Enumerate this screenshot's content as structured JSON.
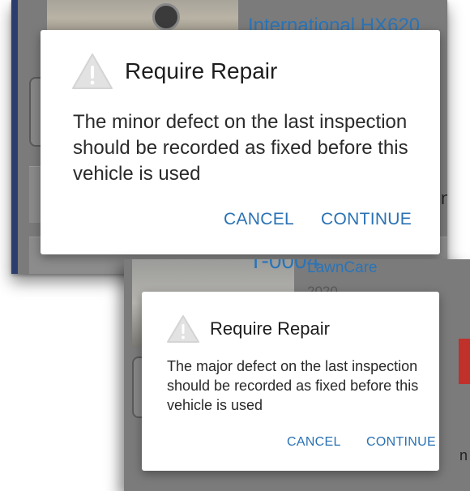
{
  "screen_top": {
    "background": {
      "vehicle_title": "International HX620"
    },
    "dialog": {
      "title": "Require Repair",
      "message": "The minor defect on the last inspection should be recorded as fixed before this vehicle is used",
      "cancel_label": "CANCEL",
      "continue_label": "CONTINUE",
      "icon": "warning-triangle-icon"
    }
  },
  "screen_bottom": {
    "background": {
      "vehicle_number": "T-0004",
      "vehicle_name": "LawnCare",
      "vehicle_year": "2020",
      "side_letter": "n"
    },
    "dialog": {
      "title": "Require Repair",
      "message": "The major defect on the last inspection should be recorded as fixed before this vehicle is used",
      "cancel_label": "CANCEL",
      "continue_label": "CONTINUE",
      "icon": "warning-triangle-icon"
    }
  },
  "colors": {
    "accent": "#2a72b4",
    "scrim": "#7b7b7b",
    "badge": "#c0312b"
  }
}
